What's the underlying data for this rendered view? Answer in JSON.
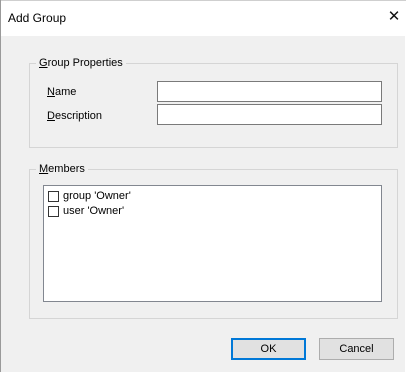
{
  "window": {
    "title": "Add Group",
    "close_glyph": "✕"
  },
  "group_properties": {
    "legend_first": "G",
    "legend_rest": "roup Properties",
    "name_label_first": "N",
    "name_label_rest": "ame",
    "name_value": "",
    "description_label_first": "D",
    "description_label_rest": "escription",
    "description_value": ""
  },
  "members": {
    "legend_first": "M",
    "legend_rest": "embers",
    "items": [
      {
        "label": "group 'Owner'",
        "checked": false
      },
      {
        "label": "user 'Owner'",
        "checked": false
      }
    ]
  },
  "buttons": {
    "ok_label": "OK",
    "cancel_label": "Cancel"
  },
  "colors": {
    "dialog_background": "#f0f0f0",
    "titlebar_background": "#ffffff",
    "default_button_border": "#0078d7"
  }
}
